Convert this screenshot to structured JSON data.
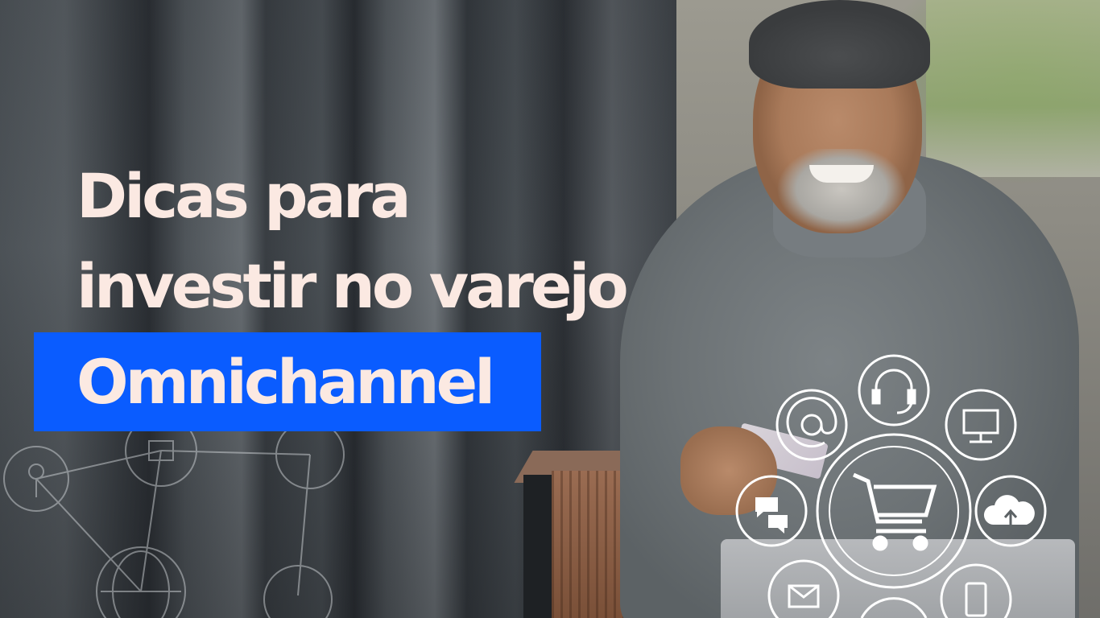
{
  "headline": {
    "line1": "Dicas para",
    "line2": "investir no varejo",
    "highlight": "Omnichannel"
  },
  "colors": {
    "headline_text": "#fbe9e2",
    "highlight_bg": "#0a5cff",
    "icon_stroke": "#ffffff"
  },
  "icons_right": [
    "at-sign-icon",
    "headset-icon",
    "monitor-icon",
    "chat-bubbles-icon",
    "shopping-cart-icon",
    "cloud-upload-icon",
    "envelope-icon",
    "smartphone-icon"
  ],
  "icons_left": [
    "person-location-icon",
    "storefront-icon",
    "satellite-icon",
    "globe-icon",
    "payment-icon"
  ]
}
